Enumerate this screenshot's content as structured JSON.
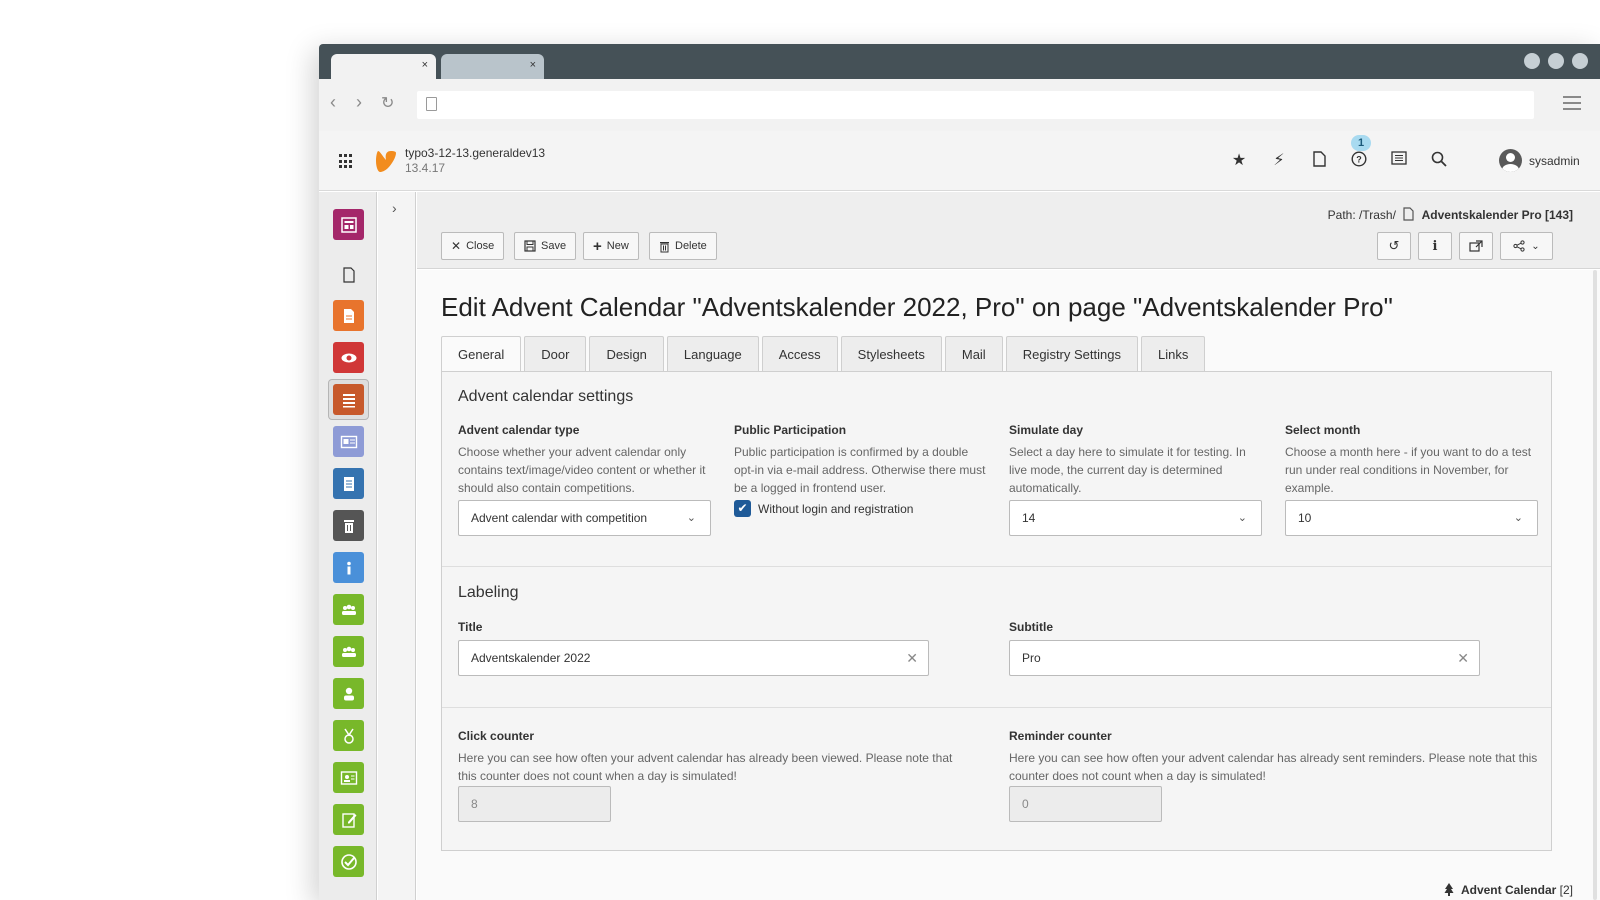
{
  "browser": {
    "tabs": [
      {
        "close": "×"
      },
      {
        "close": "×"
      }
    ]
  },
  "topbar": {
    "site_name": "typo3-12-13.generaldev13",
    "version": "13.4.17",
    "notification_count": "1",
    "user": "sysadmin"
  },
  "modules": [
    {
      "name": "page-module",
      "color": "#a4276a"
    },
    {
      "name": "list-doc-module",
      "color": "none"
    },
    {
      "name": "file-module",
      "color": "#e8742d"
    },
    {
      "name": "view-module",
      "color": "#d03737"
    },
    {
      "name": "list-module",
      "color": "#c7592b"
    },
    {
      "name": "news-module",
      "color": "#8e9bd6"
    },
    {
      "name": "records-module",
      "color": "#3573b0"
    },
    {
      "name": "recycler-module",
      "color": "#555555"
    },
    {
      "name": "info-module",
      "color": "#4a90d9"
    },
    {
      "name": "users-module",
      "color": "#78b82a"
    },
    {
      "name": "groups-module",
      "color": "#78b82a"
    },
    {
      "name": "user-module",
      "color": "#78b82a"
    },
    {
      "name": "reward-module",
      "color": "#78b82a"
    },
    {
      "name": "contact-module",
      "color": "#78b82a"
    },
    {
      "name": "edit-module",
      "color": "#78b82a"
    },
    {
      "name": "check-module",
      "color": "#78b82a"
    }
  ],
  "docheader": {
    "path_label": "Path: /Trash/",
    "record": "Adventskalender Pro [143]",
    "buttons": {
      "close": "Close",
      "save": "Save",
      "new": "New",
      "delete": "Delete"
    }
  },
  "form": {
    "title": "Edit Advent Calendar \"Adventskalender 2022, Pro\" on page \"Adventskalender Pro\"",
    "tabs": [
      "General",
      "Door",
      "Design",
      "Language",
      "Access",
      "Stylesheets",
      "Mail",
      "Registry Settings",
      "Links"
    ],
    "active_tab": "General",
    "settings": {
      "heading": "Advent calendar settings",
      "type": {
        "label": "Advent calendar type",
        "desc": "Choose whether your advent calendar only contains text/image/video content or whether it should also contain competitions.",
        "value": "Advent calendar with competition"
      },
      "participation": {
        "label": "Public Participation",
        "desc": "Public participation is confirmed by a double opt-in via e-mail address. Otherwise there must be a logged in frontend user.",
        "checkbox": "Without login and registration"
      },
      "simulate": {
        "label": "Simulate day",
        "desc": "Select a day here to simulate it for testing. In live mode, the current day is determined automatically.",
        "value": "14"
      },
      "month": {
        "label": "Select month",
        "desc": "Choose a month here - if you want to do a test run under real conditions in November, for example.",
        "value": "10"
      }
    },
    "labeling": {
      "heading": "Labeling",
      "title_label": "Title",
      "title_value": "Adventskalender 2022",
      "subtitle_label": "Subtitle",
      "subtitle_value": "Pro"
    },
    "counters": {
      "click_label": "Click counter",
      "click_desc": "Here you can see how often your advent calendar has already been viewed. Please note that this counter does not count when a day is simulated!",
      "click_value": "8",
      "reminder_label": "Reminder counter",
      "reminder_desc": "Here you can see how often your advent calendar has already sent reminders. Please note that this counter does not count when a day is simulated!",
      "reminder_value": "0"
    },
    "footer": {
      "label": "Advent Calendar",
      "count": "[2]"
    }
  }
}
